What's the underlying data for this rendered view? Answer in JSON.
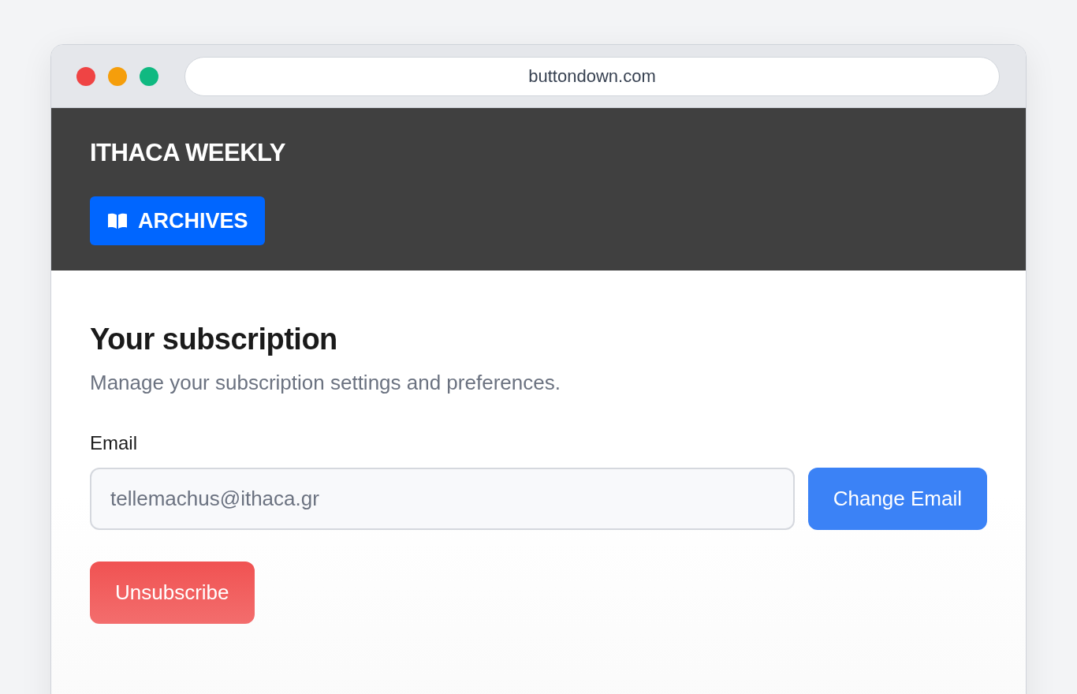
{
  "browser": {
    "window_controls": [
      {
        "color": "#ef4444"
      },
      {
        "color": "#f59e0b"
      },
      {
        "color": "#10b981"
      }
    ],
    "url": "buttondown.com"
  },
  "header": {
    "title": "ITHACA WEEKLY",
    "nav_button": {
      "label": "ARCHIVES"
    }
  },
  "content": {
    "title": "Your subscription",
    "subtitle": "Manage your subscription settings and preferences.",
    "email_field": {
      "label": "Email",
      "value": "tellemachus@ithaca.gr"
    },
    "buttons": [
      {
        "kind": "primary",
        "label": "Change Email"
      },
      {
        "kind": "danger",
        "label": "Unsubscribe"
      }
    ]
  }
}
